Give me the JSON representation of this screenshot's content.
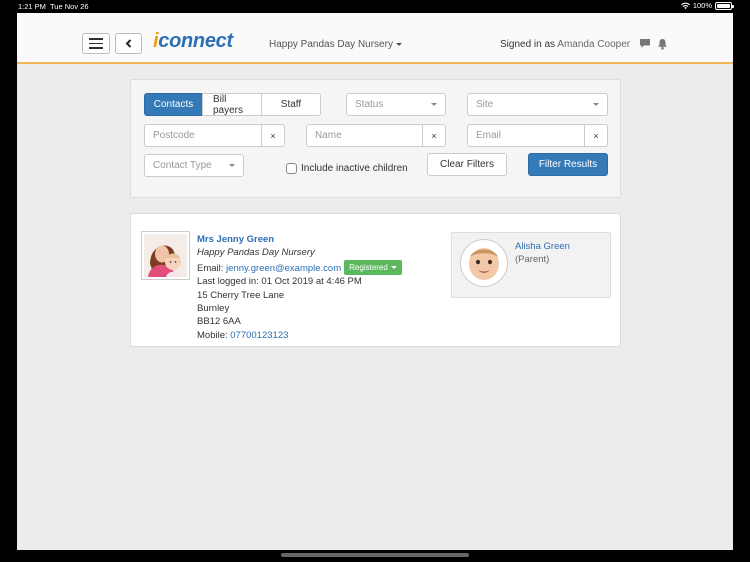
{
  "status_bar": {
    "time": "1:21 PM",
    "date": "Tue Nov 26",
    "battery": "100%"
  },
  "header": {
    "logo_i": "i",
    "logo_rest": "connect",
    "nursery": "Happy Pandas Day Nursery",
    "signed_in_prefix": "Signed in as",
    "user_name": "Amanda Cooper"
  },
  "filters": {
    "tabs": [
      {
        "label": "Contacts",
        "active": true
      },
      {
        "label": "Bill payers",
        "active": false
      },
      {
        "label": "Staff",
        "active": false
      }
    ],
    "status_placeholder": "Status",
    "site_placeholder": "Site",
    "postcode_placeholder": "Postcode",
    "name_placeholder": "Name",
    "email_placeholder": "Email",
    "clear_symbol": "×",
    "contact_type_placeholder": "Contact Type",
    "include_inactive_label": "Include inactive children",
    "clear_filters_label": "Clear Filters",
    "filter_results_label": "Filter Results"
  },
  "contact": {
    "name": "Mrs Jenny Green",
    "site": "Happy Pandas Day Nursery",
    "email_label": "Email:",
    "email": "jenny.green@example.com",
    "registration_status": "Registered",
    "last_logged_in": "Last logged in: 01 Oct 2019 at 4:46 PM",
    "address_line1": "15 Cherry Tree Lane",
    "address_line2": "Burnley",
    "postcode": "BB12 6AA",
    "mobile_label": "Mobile:",
    "mobile": "07700123123",
    "child": {
      "name": "Alisha Green",
      "role": "(Parent)"
    }
  },
  "colors": {
    "primary": "#337ab7",
    "accent": "#f0b659",
    "logo_blue": "#2c6fb5",
    "logo_orange": "#f39c12",
    "success": "#5cb85c"
  }
}
